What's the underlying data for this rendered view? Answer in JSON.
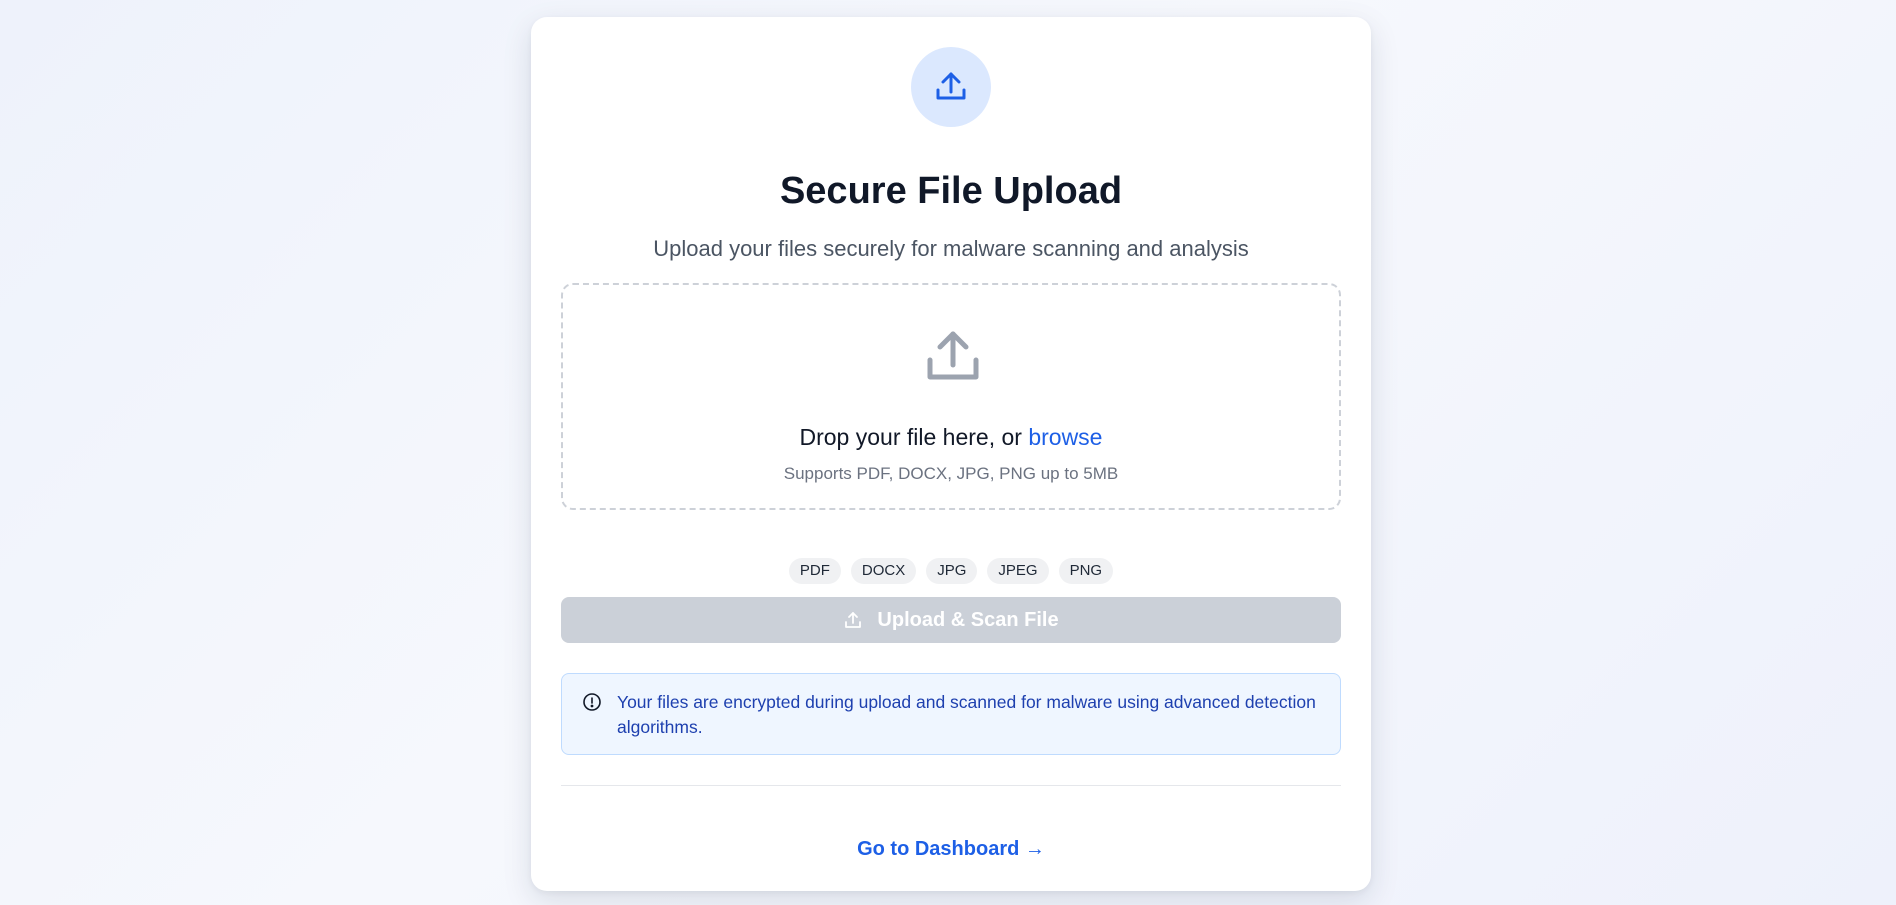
{
  "header": {
    "icon": "upload-icon",
    "title": "Secure File Upload",
    "subtitle": "Upload your files securely for malware scanning and analysis"
  },
  "dropzone": {
    "icon": "upload-tray-icon",
    "prompt": "Drop your file here, or",
    "browse_label": "browse",
    "hint": "Supports PDF, DOCX, JPG, PNG up to 5MB"
  },
  "file_types": [
    "PDF",
    "DOCX",
    "JPG",
    "JPEG",
    "PNG"
  ],
  "upload_button": {
    "label": "Upload & Scan File",
    "icon": "upload-icon",
    "state": "disabled"
  },
  "notice": {
    "icon": "info-circle-icon",
    "text": "Your files are encrypted during upload and scanned for malware using advanced detection algorithms."
  },
  "footer": {
    "dashboard_link": "Go to Dashboard →"
  },
  "colors": {
    "accent": "#1d5fe6",
    "icon_bg": "#dbe8fe",
    "disabled_button": "#cbd0d8",
    "notice_bg": "#eff6ff",
    "notice_text": "#1e40af"
  }
}
